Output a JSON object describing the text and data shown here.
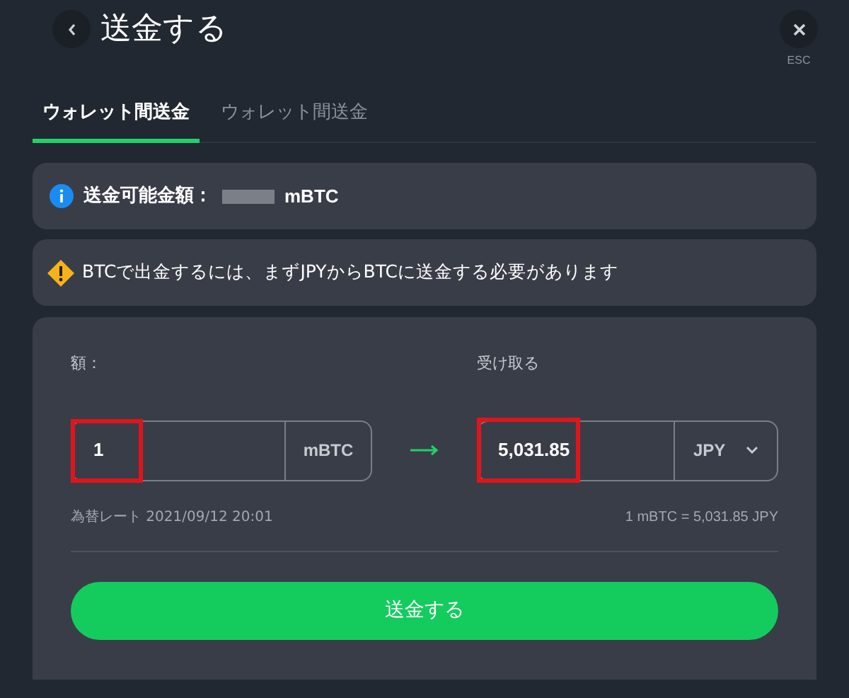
{
  "header": {
    "title": "送金する",
    "close_hint": "ESC"
  },
  "tabs": [
    {
      "label": "ウォレット間送金",
      "selected": true
    },
    {
      "label": "ウォレット間送金",
      "selected": false
    }
  ],
  "info": {
    "label": "送金可能金額：",
    "unit": "mBTC"
  },
  "warning": {
    "text": "BTCで出金するには、まずJPYからBTCに送金する必要があります"
  },
  "form": {
    "from_label": "額：",
    "to_label": "受け取る",
    "from_value": "1",
    "from_unit": "mBTC",
    "to_value": "5,031.85",
    "to_unit": "JPY",
    "rate_label": "為替レート 2021/09/12 20:01",
    "rate": "1 mBTC = 5,031.85 JPY",
    "submit": "送金する"
  }
}
